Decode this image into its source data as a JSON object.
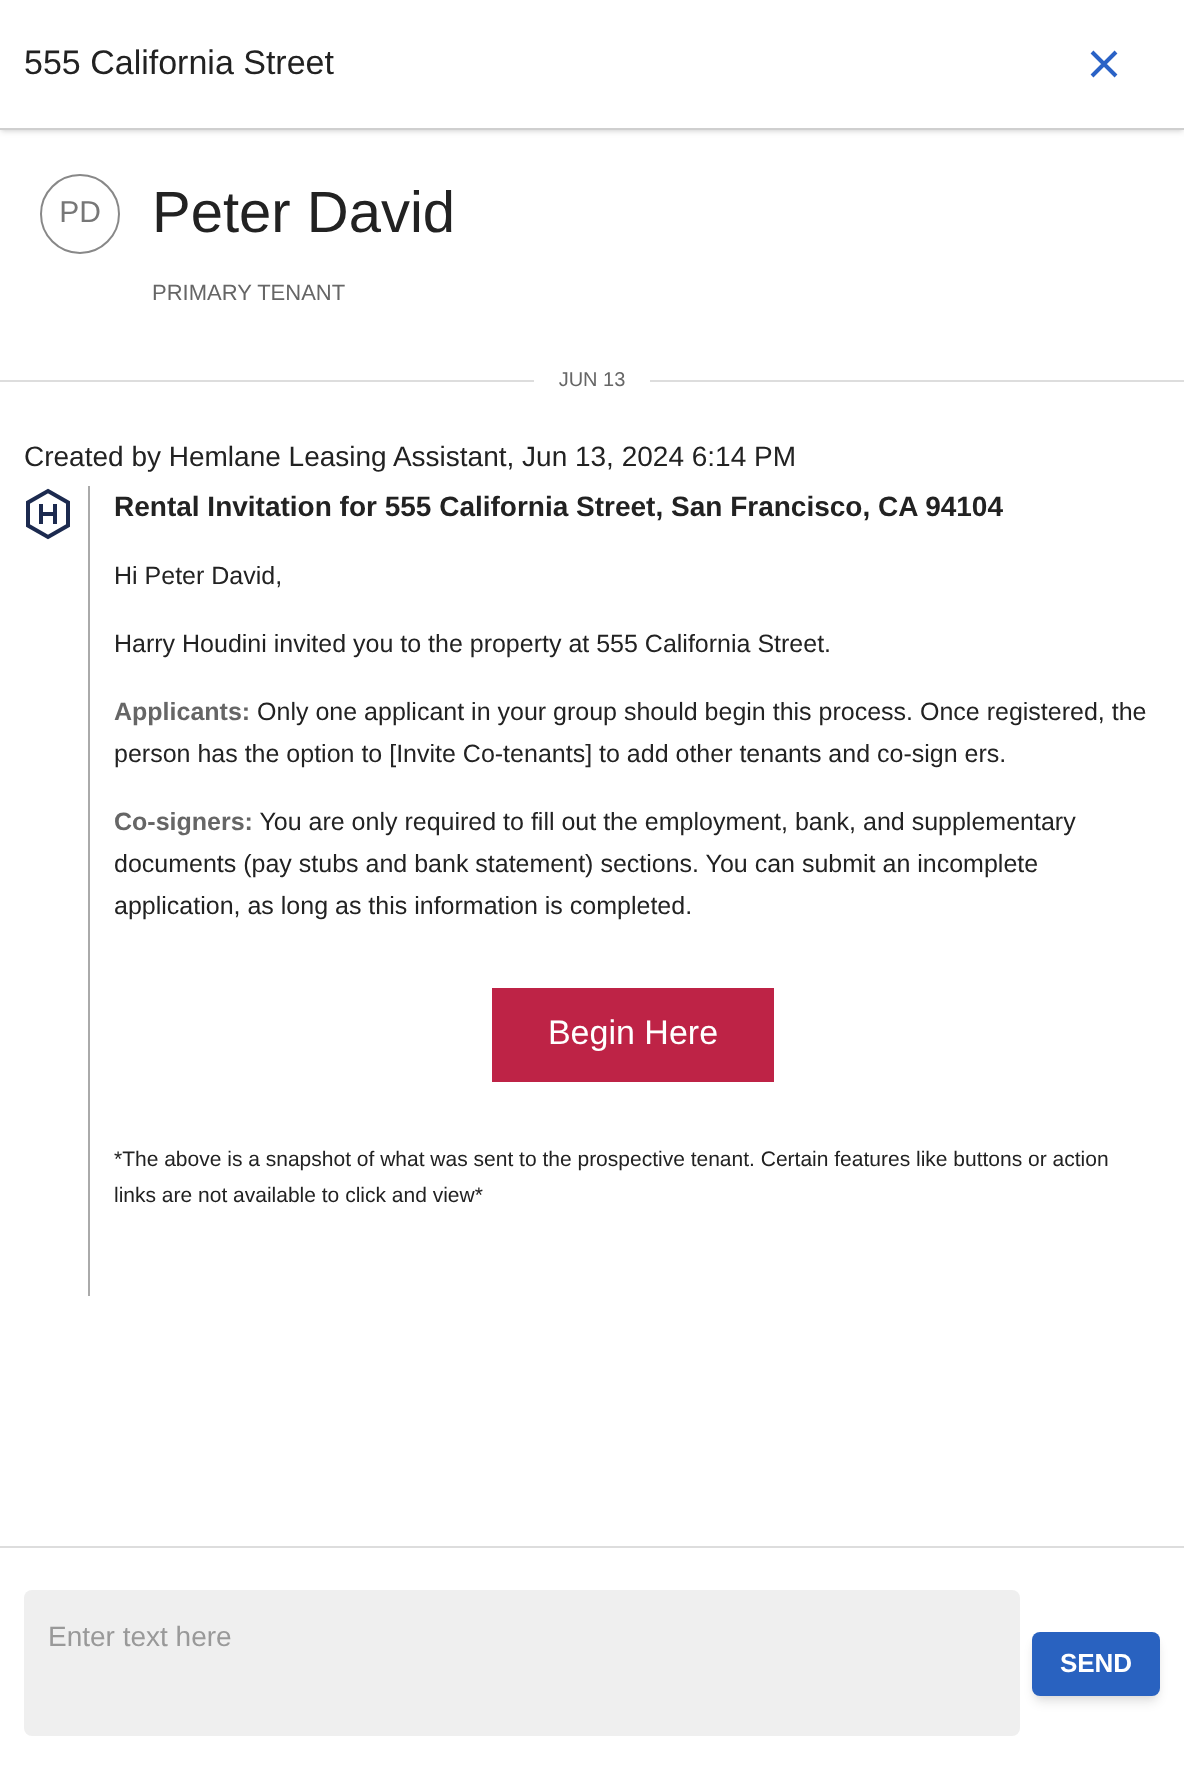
{
  "header": {
    "title": "555 California Street"
  },
  "tenant": {
    "initials": "PD",
    "name": "Peter David",
    "role": "PRIMARY TENANT"
  },
  "date_divider": "JUN 13",
  "message": {
    "created_by": "Created by Hemlane Leasing Assistant, Jun 13, 2024 6:14 PM",
    "title": "Rental Invitation for 555 California Street, San Francisco, CA 94104",
    "paragraphs": [
      "Hi Peter David,",
      "Harry Houdini invited you to the property at 555 California Street.",
      "**Applicants:** Only one applicant in your group should begin this process. Once registered, the person has the option to [Invite Co-tenants] to add other tenants and co-sign ers.",
      "**Co-signers:** You are only required to fill out the employment, bank, and supplementary documents (pay stubs and bank statement) sections. You can submit an incomplete application, as long as this information is completed."
    ],
    "button": "Begin Here",
    "footnote": "*The above is a snapshot of what was sent to the prospective tenant. Certain features like buttons or action links are not available to click and view*"
  },
  "composer": {
    "placeholder": "Enter text here",
    "send": "SEND"
  }
}
